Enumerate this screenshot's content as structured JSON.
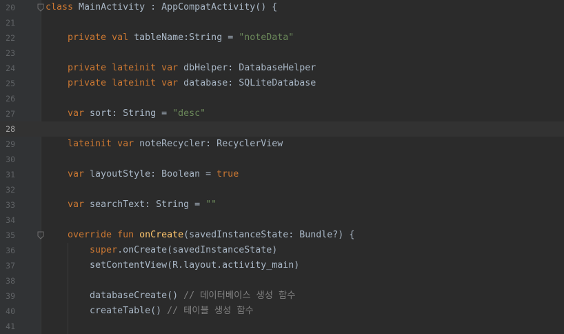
{
  "editor": {
    "lines": [
      {
        "num": "20",
        "fold": "class",
        "tokens": [
          {
            "t": "class ",
            "c": "kw"
          },
          {
            "t": "MainActivity : AppCompatActivity() {",
            "c": "tx"
          }
        ]
      },
      {
        "num": "21",
        "tokens": []
      },
      {
        "num": "22",
        "tokens": [
          {
            "t": "    private ",
            "c": "kw"
          },
          {
            "t": "val ",
            "c": "kw"
          },
          {
            "t": "tableName:String = ",
            "c": "tx"
          },
          {
            "t": "\"noteData\"",
            "c": "str"
          }
        ]
      },
      {
        "num": "23",
        "tokens": []
      },
      {
        "num": "24",
        "tokens": [
          {
            "t": "    private ",
            "c": "kw"
          },
          {
            "t": "lateinit ",
            "c": "kw"
          },
          {
            "t": "var ",
            "c": "kw"
          },
          {
            "t": "dbHelper: DatabaseHelper",
            "c": "tx"
          }
        ]
      },
      {
        "num": "25",
        "tokens": [
          {
            "t": "    private ",
            "c": "kw"
          },
          {
            "t": "lateinit ",
            "c": "kw"
          },
          {
            "t": "var ",
            "c": "kw"
          },
          {
            "t": "database: SQLiteDatabase",
            "c": "tx"
          }
        ]
      },
      {
        "num": "26",
        "tokens": []
      },
      {
        "num": "27",
        "tokens": [
          {
            "t": "    var ",
            "c": "kw"
          },
          {
            "t": "sort: String = ",
            "c": "tx"
          },
          {
            "t": "\"desc\"",
            "c": "str"
          }
        ]
      },
      {
        "num": "28",
        "current": true,
        "tokens": []
      },
      {
        "num": "29",
        "tokens": [
          {
            "t": "    lateinit ",
            "c": "kw"
          },
          {
            "t": "var ",
            "c": "kw"
          },
          {
            "t": "noteRecycler: RecyclerView",
            "c": "tx"
          }
        ]
      },
      {
        "num": "30",
        "tokens": []
      },
      {
        "num": "31",
        "tokens": [
          {
            "t": "    var ",
            "c": "kw"
          },
          {
            "t": "layoutStyle: Boolean = ",
            "c": "tx"
          },
          {
            "t": "true",
            "c": "kw"
          }
        ]
      },
      {
        "num": "32",
        "tokens": []
      },
      {
        "num": "33",
        "tokens": [
          {
            "t": "    var ",
            "c": "kw"
          },
          {
            "t": "searchText: String = ",
            "c": "tx"
          },
          {
            "t": "\"\"",
            "c": "str"
          }
        ]
      },
      {
        "num": "34",
        "tokens": []
      },
      {
        "num": "35",
        "fold": "method",
        "tokens": [
          {
            "t": "    override ",
            "c": "kw"
          },
          {
            "t": "fun ",
            "c": "kw"
          },
          {
            "t": "onCreate",
            "c": "fn"
          },
          {
            "t": "(savedInstanceState: Bundle?) {",
            "c": "tx"
          }
        ]
      },
      {
        "num": "36",
        "tokens": [
          {
            "t": "        super",
            "c": "kw"
          },
          {
            "t": ".onCreate(savedInstanceState)",
            "c": "tx"
          }
        ]
      },
      {
        "num": "37",
        "tokens": [
          {
            "t": "        setContentView(R.layout.activity_main)",
            "c": "tx"
          }
        ]
      },
      {
        "num": "38",
        "tokens": []
      },
      {
        "num": "39",
        "tokens": [
          {
            "t": "        databaseCreate() ",
            "c": "tx"
          },
          {
            "t": "// 데이터베이스 생성 함수",
            "c": "cmt"
          }
        ]
      },
      {
        "num": "40",
        "tokens": [
          {
            "t": "        createTable() ",
            "c": "tx"
          },
          {
            "t": "// 테이블 생성 함수",
            "c": "cmt"
          }
        ]
      },
      {
        "num": "41",
        "tokens": []
      }
    ]
  },
  "colors": {
    "background": "#2b2b2b",
    "gutter": "#313335",
    "keyword": "#cc7832",
    "string": "#6a8759",
    "function": "#ffc66d",
    "comment": "#808080",
    "text": "#a9b7c6",
    "line_number": "#606366",
    "current_line": "#323232"
  }
}
